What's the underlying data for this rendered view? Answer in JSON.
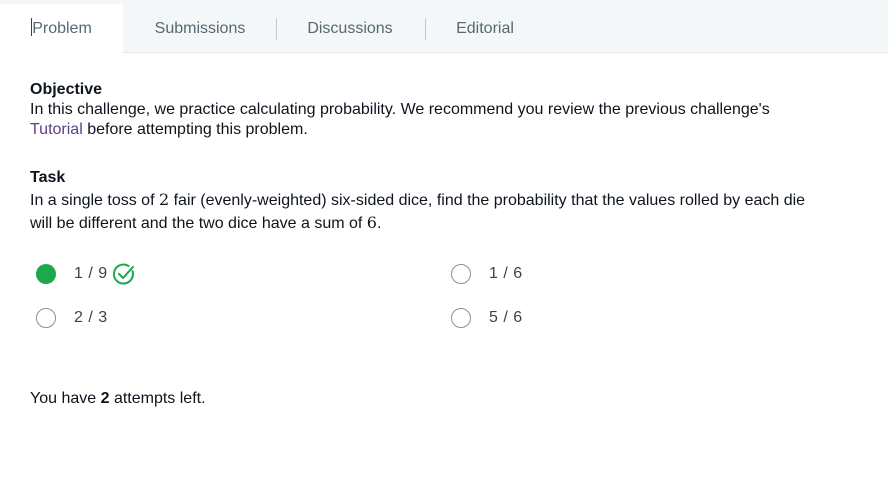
{
  "tabs": [
    {
      "label": "Problem"
    },
    {
      "label": "Submissions"
    },
    {
      "label": "Discussions"
    },
    {
      "label": "Editorial"
    }
  ],
  "objective": {
    "heading": "Objective",
    "text_before_link": "In this challenge, we practice calculating probability. We recommend you review the previous challenge's",
    "link_text": "Tutorial",
    "text_after_link": " before attempting this problem."
  },
  "task": {
    "heading": "Task",
    "line1_a": "In a single toss of ",
    "line1_num": "2",
    "line1_b": " fair (evenly-weighted) six-sided dice, find the probability that the values rolled by each die",
    "line2_a": "will be different and the two dice have a sum of ",
    "line2_num": "6",
    "line2_b": "."
  },
  "options": [
    {
      "label": "1 / 9",
      "selected": true,
      "correct": true
    },
    {
      "label": "1 / 6",
      "selected": false,
      "correct": false
    },
    {
      "label": "2 / 3",
      "selected": false,
      "correct": false
    },
    {
      "label": "5 / 6",
      "selected": false,
      "correct": false
    }
  ],
  "attempts": {
    "prefix": "You have ",
    "count": "2",
    "suffix": " attempts left."
  },
  "colors": {
    "selected_green": "#1ba94c",
    "link_purple": "#5b3f8c",
    "tab_bar_bg": "#f3f7f7"
  }
}
